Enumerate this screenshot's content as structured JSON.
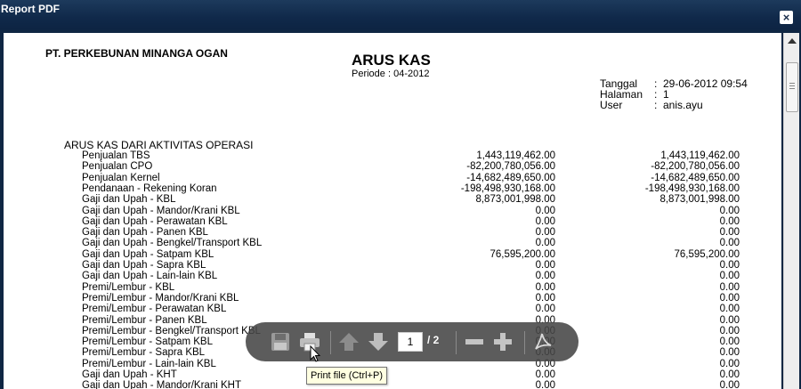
{
  "window": {
    "title": "Report PDF",
    "close_label": "×"
  },
  "report": {
    "company": "PT. PERKEBUNAN MINANGA OGAN",
    "title": "ARUS KAS",
    "period": "Periode : 04-2012",
    "meta": [
      {
        "key": "Tanggal",
        "colon": ":",
        "value": "29-06-2012 09:54"
      },
      {
        "key": "Halaman",
        "colon": ":",
        "value": "1"
      },
      {
        "key": "User",
        "colon": ":",
        "value": "anis.ayu"
      }
    ],
    "section_title": "ARUS KAS DARI AKTIVITAS OPERASI",
    "rows": [
      {
        "label": "Penjualan TBS",
        "v1": "1,443,119,462.00",
        "v2": "1,443,119,462.00"
      },
      {
        "label": "Penjualan CPO",
        "v1": "-82,200,780,056.00",
        "v2": "-82,200,780,056.00"
      },
      {
        "label": "Penjualan Kernel",
        "v1": "-14,682,489,650.00",
        "v2": "-14,682,489,650.00"
      },
      {
        "label": "Pendanaan - Rekening Koran",
        "v1": "-198,498,930,168.00",
        "v2": "-198,498,930,168.00"
      },
      {
        "label": "Gaji dan Upah - KBL",
        "v1": "8,873,001,998.00",
        "v2": "8,873,001,998.00"
      },
      {
        "label": "Gaji dan Upah - Mandor/Krani KBL",
        "v1": "0.00",
        "v2": "0.00"
      },
      {
        "label": "Gaji dan Upah - Perawatan KBL",
        "v1": "0.00",
        "v2": "0.00"
      },
      {
        "label": "Gaji dan Upah - Panen KBL",
        "v1": "0.00",
        "v2": "0.00"
      },
      {
        "label": "Gaji dan Upah - Bengkel/Transport KBL",
        "v1": "0.00",
        "v2": "0.00"
      },
      {
        "label": "Gaji dan Upah - Satpam KBL",
        "v1": "76,595,200.00",
        "v2": "76,595,200.00"
      },
      {
        "label": "Gaji dan Upah - Sapra KBL",
        "v1": "0.00",
        "v2": "0.00"
      },
      {
        "label": "Gaji dan Upah - Lain-lain KBL",
        "v1": "0.00",
        "v2": "0.00"
      },
      {
        "label": "Premi/Lembur - KBL",
        "v1": "0.00",
        "v2": "0.00"
      },
      {
        "label": "Premi/Lembur - Mandor/Krani KBL",
        "v1": "0.00",
        "v2": "0.00"
      },
      {
        "label": "Premi/Lembur - Perawatan KBL",
        "v1": "0.00",
        "v2": "0.00"
      },
      {
        "label": "Premi/Lembur - Panen KBL",
        "v1": "0.00",
        "v2": "0.00"
      },
      {
        "label": "Premi/Lembur - Bengkel/Transport KBL",
        "v1": "0.00",
        "v2": "0.00"
      },
      {
        "label": "Premi/Lembur - Satpam KBL",
        "v1": "0.00",
        "v2": "0.00"
      },
      {
        "label": "Premi/Lembur - Sapra KBL",
        "v1": "0.00",
        "v2": "0.00"
      },
      {
        "label": "Premi/Lembur - Lain-lain KBL",
        "v1": "0.00",
        "v2": "0.00"
      },
      {
        "label": "Gaji dan Upah - KHT",
        "v1": "0.00",
        "v2": "0.00"
      },
      {
        "label": "Gaji dan Upah - Mandor/Krani KHT",
        "v1": "0.00",
        "v2": "0.00"
      }
    ]
  },
  "pdf_toolbar": {
    "current_page": "1",
    "total_pages": "/ 2",
    "icons": [
      "save-icon",
      "print-icon",
      "page-up-icon",
      "page-down-icon",
      "zoom-out-icon",
      "zoom-in-icon",
      "adobe-acrobat-icon"
    ]
  },
  "tooltip": {
    "text": "Print file (Ctrl+P)"
  }
}
